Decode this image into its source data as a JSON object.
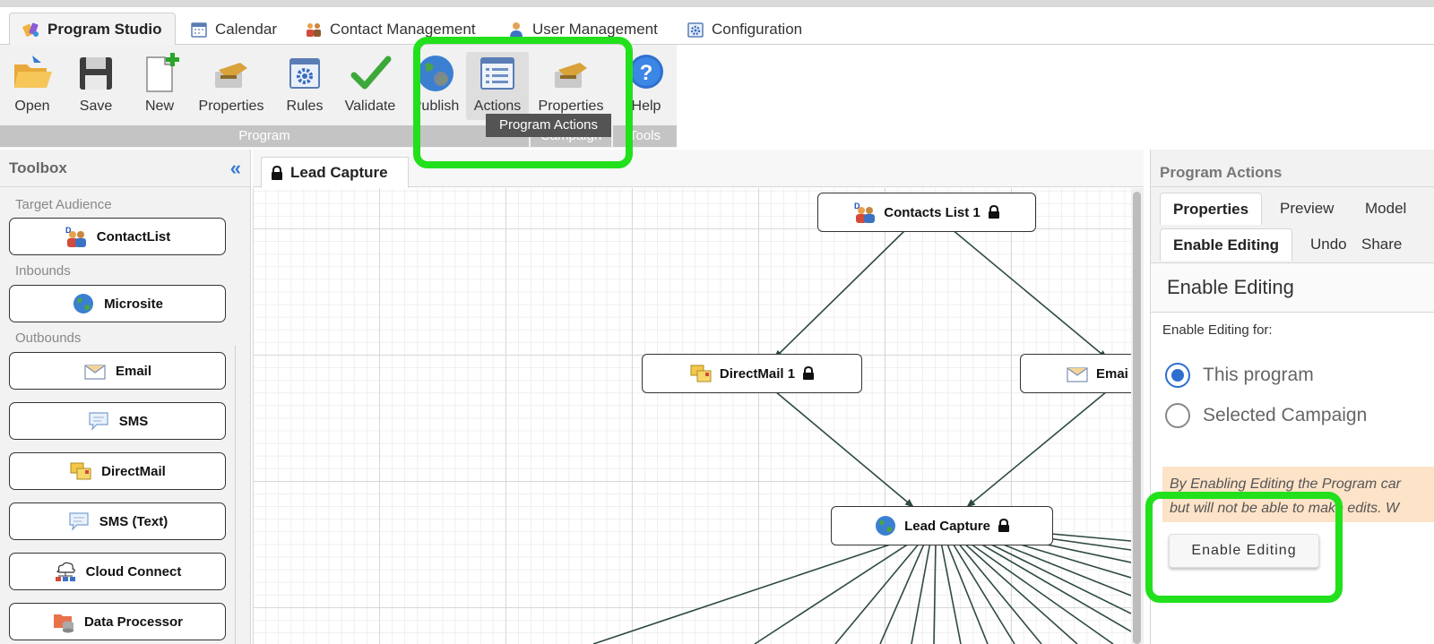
{
  "top_tabs": [
    {
      "label": "Program Studio",
      "icon": "program-studio-icon",
      "active": true
    },
    {
      "label": "Calendar",
      "icon": "calendar-icon"
    },
    {
      "label": "Contact Management",
      "icon": "contacts-icon"
    },
    {
      "label": "User Management",
      "icon": "user-icon"
    },
    {
      "label": "Configuration",
      "icon": "configuration-icon"
    }
  ],
  "ribbon": {
    "buttons": [
      {
        "label": "Open",
        "icon": "folder-open-icon"
      },
      {
        "label": "Save",
        "icon": "floppy-disk-icon"
      },
      {
        "label": "New",
        "icon": "new-document-icon"
      },
      {
        "label": "Properties",
        "icon": "properties-hand-icon"
      },
      {
        "label": "Rules",
        "icon": "rules-gear-icon"
      },
      {
        "label": "Validate",
        "icon": "checkmark-icon"
      },
      {
        "label": "Publish",
        "icon": "globe-icon"
      },
      {
        "label": "Actions",
        "icon": "actions-list-icon"
      },
      {
        "label": "Properties",
        "icon": "properties-hand-icon"
      },
      {
        "label": "Help",
        "icon": "help-icon"
      }
    ],
    "groups": [
      "Program",
      "Campaign",
      "Tools"
    ],
    "tooltip": "Program Actions"
  },
  "toolbox": {
    "title": "Toolbox",
    "collapse_glyph": "«",
    "sections": [
      {
        "title": "Target Audience",
        "items": [
          {
            "label": "ContactList",
            "icon": "contact-list-icon"
          }
        ]
      },
      {
        "title": "Inbounds",
        "items": [
          {
            "label": "Microsite",
            "icon": "globe-icon"
          }
        ]
      },
      {
        "title": "Outbounds",
        "items": [
          {
            "label": "Email",
            "icon": "email-envelope-icon"
          },
          {
            "label": "SMS",
            "icon": "speech-bubble-icon"
          },
          {
            "label": "DirectMail",
            "icon": "direct-mail-icon"
          },
          {
            "label": "SMS (Text)",
            "icon": "speech-bubble-icon"
          },
          {
            "label": "Cloud Connect",
            "icon": "cloud-connect-icon"
          },
          {
            "label": "Data Processor",
            "icon": "data-processor-icon"
          }
        ]
      }
    ]
  },
  "canvas": {
    "tab_label": "Lead Capture",
    "nodes": [
      {
        "id": "contacts",
        "label": "Contacts List 1",
        "icon": "contact-list-icon",
        "locked": true
      },
      {
        "id": "directmail",
        "label": "DirectMail 1",
        "icon": "direct-mail-icon",
        "locked": true
      },
      {
        "id": "email",
        "label": "Emai",
        "icon": "email-envelope-icon",
        "locked": false
      },
      {
        "id": "lead",
        "label": "Lead Capture",
        "icon": "globe-icon",
        "locked": true
      }
    ]
  },
  "right_panel": {
    "title": "Program Actions",
    "tabs_row1": [
      "Properties",
      "Preview",
      "Model"
    ],
    "tabs_row2": [
      "Enable Editing",
      "Undo",
      "Share"
    ],
    "section_title": "Enable Editing",
    "enable_for_label": "Enable Editing for:",
    "options": [
      {
        "label": "This program",
        "selected": true
      },
      {
        "label": "Selected Campaign",
        "selected": false
      }
    ],
    "warning_line1": "By Enabling Editing the Program car",
    "warning_line2": "but will not be able to make edits. W",
    "button_label": "Enable Editing"
  },
  "highlight_color": "#22e01c"
}
